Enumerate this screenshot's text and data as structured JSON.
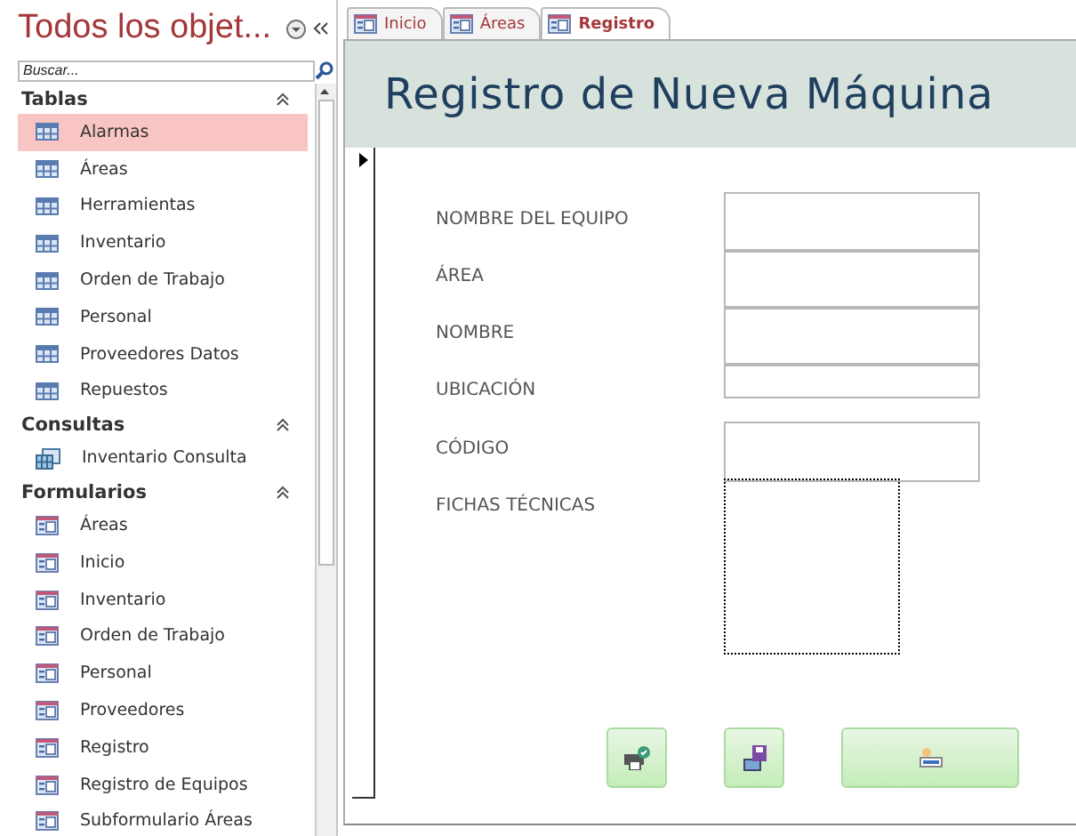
{
  "nav": {
    "title": "Todos los objet...",
    "search": {
      "placeholder": "Buscar..."
    },
    "groups": [
      {
        "label": "Tablas",
        "expanded": true,
        "items": [
          {
            "label": "Alarmas",
            "kind": "table",
            "selected": true
          },
          {
            "label": "Áreas",
            "kind": "table",
            "selected": false
          },
          {
            "label": "Herramientas",
            "kind": "table",
            "selected": false
          },
          {
            "label": "Inventario",
            "kind": "table",
            "selected": false
          },
          {
            "label": "Orden de Trabajo",
            "kind": "table",
            "selected": false
          },
          {
            "label": "Personal",
            "kind": "table",
            "selected": false
          },
          {
            "label": "Proveedores Datos",
            "kind": "table",
            "selected": false
          },
          {
            "label": "Repuestos",
            "kind": "table",
            "selected": false
          }
        ]
      },
      {
        "label": "Consultas",
        "expanded": true,
        "items": [
          {
            "label": "Inventario Consulta",
            "kind": "query",
            "selected": false
          }
        ]
      },
      {
        "label": "Formularios",
        "expanded": true,
        "items": [
          {
            "label": "Áreas",
            "kind": "form",
            "selected": false
          },
          {
            "label": "Inicio",
            "kind": "form",
            "selected": false
          },
          {
            "label": "Inventario",
            "kind": "form",
            "selected": false
          },
          {
            "label": "Orden de Trabajo",
            "kind": "form",
            "selected": false
          },
          {
            "label": "Personal",
            "kind": "form",
            "selected": false
          },
          {
            "label": "Proveedores",
            "kind": "form",
            "selected": false
          },
          {
            "label": "Registro",
            "kind": "form",
            "selected": false
          },
          {
            "label": "Registro de Equipos",
            "kind": "form",
            "selected": false
          },
          {
            "label": "Subformulario Áreas",
            "kind": "form",
            "selected": false
          }
        ]
      }
    ]
  },
  "tabs": [
    {
      "label": "Inicio",
      "selected": false
    },
    {
      "label": "Áreas",
      "selected": false
    },
    {
      "label": "Registro",
      "selected": true
    }
  ],
  "form": {
    "title": "Registro de Nueva Máquina",
    "fields": [
      {
        "label": "NOMBRE DEL EQUIPO",
        "kind": "text"
      },
      {
        "label": "ÁREA",
        "kind": "text"
      },
      {
        "label": "NOMBRE",
        "kind": "text"
      },
      {
        "label": "UBICACIÓN",
        "kind": "short"
      },
      {
        "label": "CÓDIGO",
        "kind": "text"
      },
      {
        "label": "FICHAS TÉCNICAS",
        "kind": "image"
      }
    ],
    "buttons": [
      {
        "kind": "print"
      },
      {
        "kind": "save"
      },
      {
        "kind": "new"
      }
    ]
  }
}
